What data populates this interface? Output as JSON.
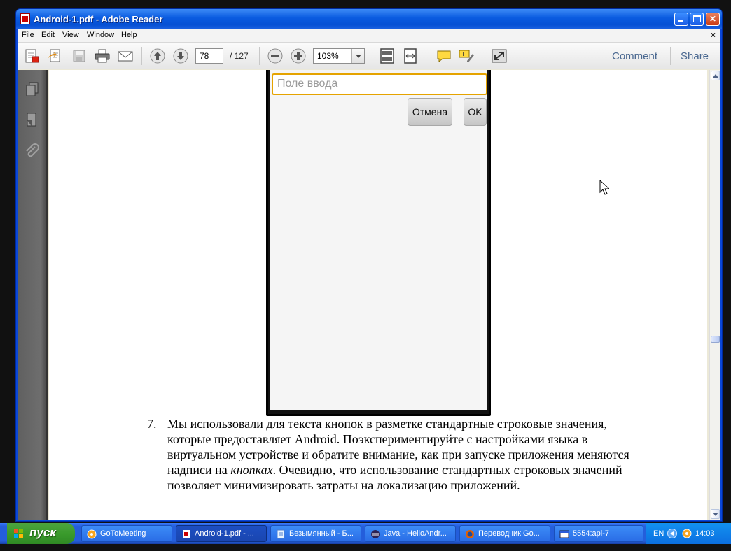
{
  "window": {
    "title": "Android-1.pdf - Adobe Reader",
    "minimize": "",
    "maximize": "",
    "close": "✕"
  },
  "menu": {
    "items": [
      "File",
      "Edit",
      "View",
      "Window",
      "Help"
    ],
    "close": "×"
  },
  "toolbar": {
    "page_current": "78",
    "page_total": "/  127",
    "zoom": "103%",
    "comment_label": "Comment",
    "share_label": "Share"
  },
  "document": {
    "phone": {
      "input_placeholder": "Поле ввода",
      "cancel_label": "Отмена",
      "ok_label": "OK"
    },
    "item_number": "7.",
    "para_part1": "Мы использовали для текста кнопок в разметке стандартные строковые значения, которые предоставляет Android. Поэкспериментируйте с настройками языка в виртуальном устройстве и обратите внимание, как при запуске приложения меняются надписи на ",
    "para_italic": "кнопках",
    "para_part2": ". Очевидно, что использование стандартных строковых значений позволяет минимизировать затраты на локализацию приложений."
  },
  "taskbar": {
    "start_label": "пуск",
    "tasks": [
      {
        "label": "GoToMeeting",
        "icon": "gotomeeting-icon",
        "active": false
      },
      {
        "label": "Android-1.pdf - ...",
        "icon": "pdf-icon",
        "active": true
      },
      {
        "label": "Безымянный - Б...",
        "icon": "notepad-icon",
        "active": false
      },
      {
        "label": "Java - HelloAndr...",
        "icon": "eclipse-icon",
        "active": false
      },
      {
        "label": "Переводчик Go...",
        "icon": "firefox-icon",
        "active": false
      },
      {
        "label": "5554:api-7",
        "icon": "emulator-window-icon",
        "active": false
      }
    ],
    "tray": {
      "lang": "EN",
      "clock": "14:03"
    }
  },
  "colors": {
    "titlebar": "#0a5be0",
    "input_focus_border": "#e5a300",
    "taskbar": "#245edb",
    "start_green": "#3a9b2c"
  }
}
